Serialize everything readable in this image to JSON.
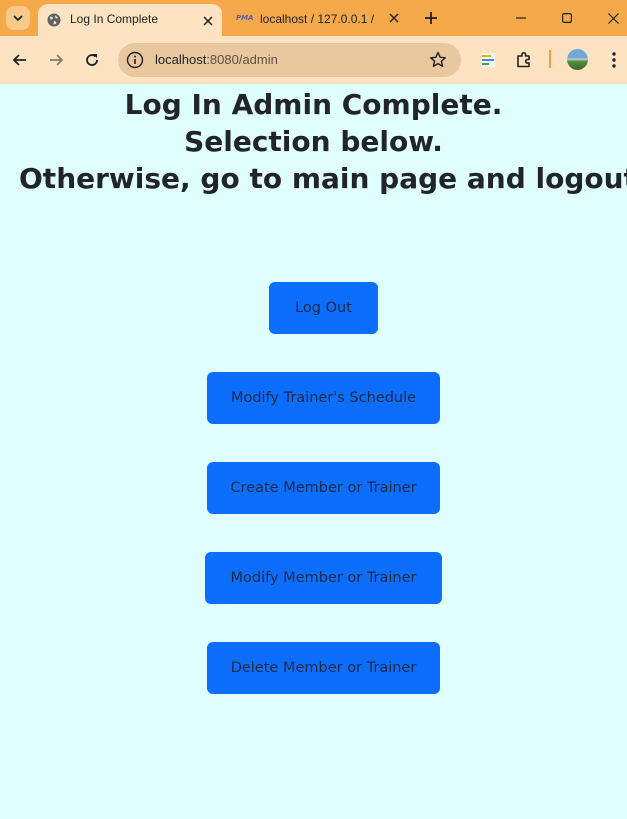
{
  "browser": {
    "tabs": [
      {
        "title": "Log In Complete",
        "active": true,
        "favicon": "globe-icon"
      },
      {
        "title": "localhost / 127.0.0.1 / ",
        "active": false,
        "favicon": "phpmyadmin-icon",
        "favicon_text": "PMA"
      }
    ],
    "address_bar": {
      "host": "localhost",
      "path": ":8080/admin"
    },
    "colors": {
      "tab_strip": "#f6a94a",
      "toolbar": "#fde3c1",
      "omnibox": "#e9c89f"
    }
  },
  "page": {
    "background": "#e0ffff",
    "heading_lines": [
      "Log In Admin Complete.",
      "Selection below.",
      "Otherwise, go to main page and logout!"
    ],
    "buttons": [
      {
        "label": "Log Out"
      },
      {
        "label": "Modify Trainer's Schedule"
      },
      {
        "label": "Create Member or Trainer"
      },
      {
        "label": "Modify Member or Trainer"
      },
      {
        "label": "Delete Member or Trainer"
      }
    ],
    "button_color": "#0d6efd"
  }
}
